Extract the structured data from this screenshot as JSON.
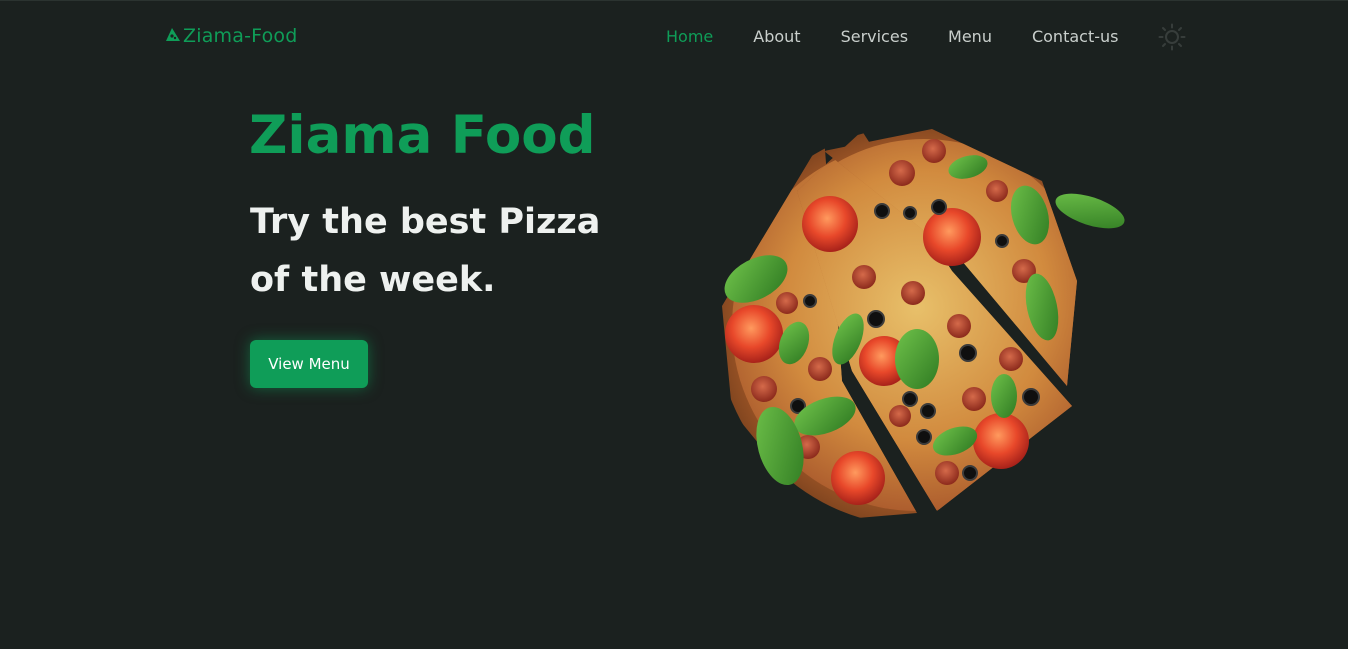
{
  "header": {
    "logo_text": "Ziama-Food",
    "nav": [
      {
        "label": "Home",
        "active": true
      },
      {
        "label": "About",
        "active": false
      },
      {
        "label": "Services",
        "active": false
      },
      {
        "label": "Menu",
        "active": false
      },
      {
        "label": "Contact-us",
        "active": false
      }
    ],
    "theme_toggle_icon": "sun-icon"
  },
  "hero": {
    "title": "Ziama Food",
    "subtitle": "Try the best Pizza of the week.",
    "cta_label": "View Menu",
    "image_icon": "pizza-image"
  },
  "colors": {
    "background": "#1b211f",
    "accent": "#0f9d58",
    "heading_text": "#eef1ef",
    "nav_text": "#c9cfcc"
  }
}
